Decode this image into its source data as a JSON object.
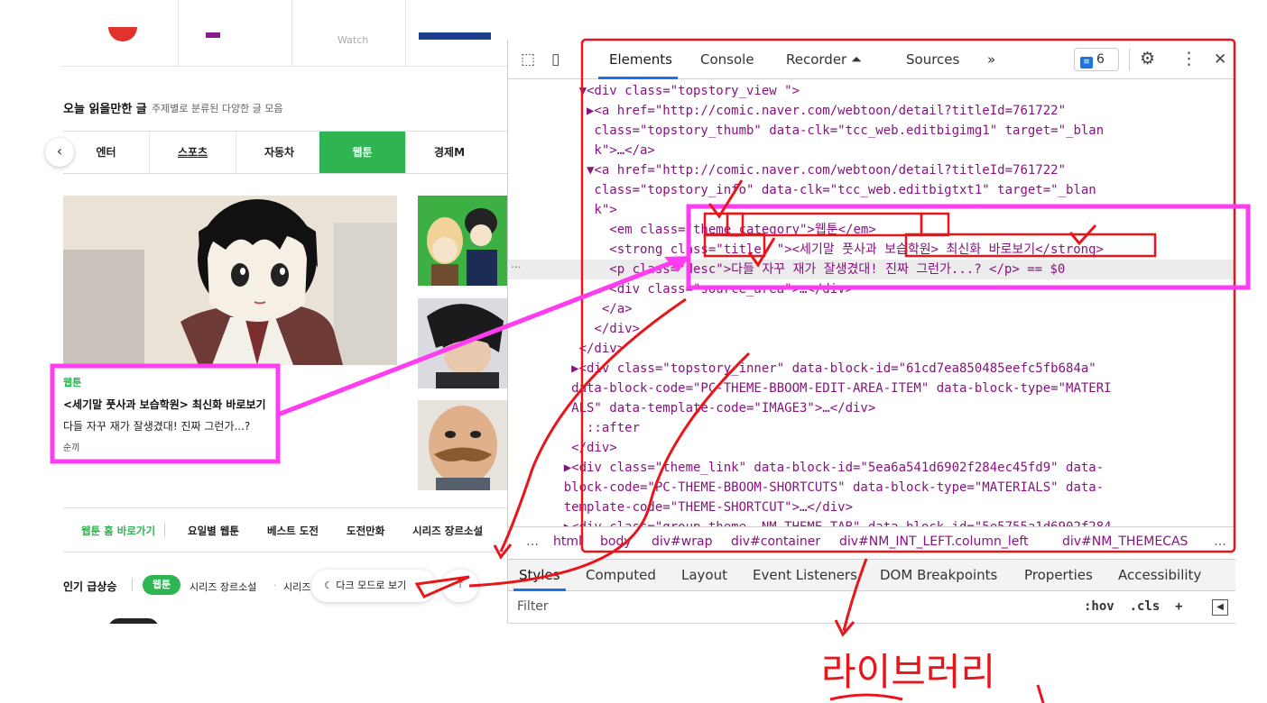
{
  "colors": {
    "accent_green": "#2eb451",
    "annotation_red": "#e8151b",
    "annotation_magenta": "#ff3cf0",
    "devtools_tag": "#881280",
    "devtools_attr": "#994500",
    "devtools_value": "#1a1aa6"
  },
  "page": {
    "top_strip_text": "Watch",
    "section_title": "오늘 읽을만한 글",
    "section_subtitle": "주제별로 분류된 다양한 글 모음",
    "prev_arrow": "‹",
    "tabs": [
      {
        "label": "엔터"
      },
      {
        "label": "스포츠"
      },
      {
        "label": "자동차"
      },
      {
        "label": "웹툰"
      },
      {
        "label": "경제M"
      }
    ],
    "card": {
      "category": "웹툰",
      "title": "<세기말 풋사과 보습학원> 최신화 바로보기",
      "desc": "다들 자꾸 재가 잘생겼대! 진짜 그런가...?",
      "source": "순끼"
    },
    "links": {
      "home": "웹툰 홈 바로가기",
      "weekday": "요일별 웹툰",
      "best": "베스트 도전",
      "challenge": "도전만화",
      "series": "시리즈 장르소설"
    },
    "popular": {
      "label": "인기 급상승",
      "pill": "웹툰",
      "series1": "시리즈 장르소설",
      "dot": "·",
      "series2": "시리즈",
      "dark_mode": "다크 모드로 보기",
      "moon": "☾",
      "top_arrow": "⤒"
    }
  },
  "devtools": {
    "inspect_icon": "⬚",
    "device_icon": "▯",
    "tabs": {
      "elements": "Elements",
      "console": "Console",
      "recorder": "Recorder ⏶",
      "sources": "Sources",
      "more": "»"
    },
    "issues_count": "6",
    "gear": "⚙",
    "kebab": "⋮",
    "close": "✕",
    "code_lines": [
      "      ▼<div class=\"topstory_view \">",
      "       ▶<a href=\"http://comic.naver.com/webtoon/detail?titleId=761722\"",
      "        class=\"topstory_thumb\" data-clk=\"tcc_web.editbigimg1\" target=\"_blan",
      "        k\">…</a>",
      "       ▼<a href=\"http://comic.naver.com/webtoon/detail?titleId=761722\"",
      "        class=\"topstory_info\" data-clk=\"tcc_web.editbigtxt1\" target=\"_blan",
      "        k\">",
      "          <em class=\"theme_category\">웹툰</em>",
      "          <strong class=\"title  \"><세기말 풋사과 보습학원> 최신화 바로보기</strong>",
      "          <p class=\"desc\">다들 자꾸 재가 잘생겼대! 진짜 그런가...? </p> == $0",
      "          <div class=\"source_area\">…</div>",
      "         </a>",
      "        </div>",
      "      </div>",
      "     ▶<div class=\"topstory_inner\" data-block-id=\"61cd7ea850485eefc5fb684a\"",
      "     data-block-code=\"PC-THEME-BBOOM-EDIT-AREA-ITEM\" data-block-type=\"MATERI",
      "     ALS\" data-template-code=\"IMAGE3\">…</div>",
      "       ::after",
      "     </div>",
      "    ▶<div class=\"theme_link\" data-block-id=\"5ea6a541d6902f284ec45fd9\" data-",
      "    block-code=\"PC-THEME-BBOOM-SHORTCUTS\" data-block-type=\"MATERIALS\" data-",
      "    template-code=\"THEME-SHORTCUT\">…</div>",
      "    ▶<div class=\"group_theme _NM_THEME_TAB\" data-block-id=\"5e5755a1d6902f284"
    ],
    "breadcrumb": [
      "…",
      "html",
      "body",
      "div#wrap",
      "div#container",
      "div#NM_INT_LEFT.column_left",
      "div#NM_THEMECAS",
      "…"
    ],
    "panel_tabs": [
      "Styles",
      "Computed",
      "Layout",
      "Event Listeners",
      "DOM Breakpoints",
      "Properties",
      "Accessibility"
    ],
    "filter_placeholder": "Filter",
    "filter_tools": ":hov  .cls  +",
    "gutter_dots": "..."
  },
  "annotation": {
    "handwritten": "라이브러리"
  }
}
